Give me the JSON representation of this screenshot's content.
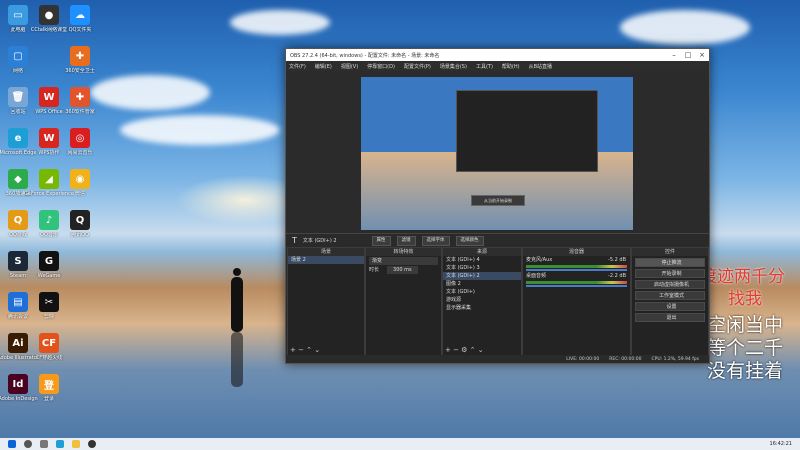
{
  "desktop_icons": [
    {
      "label": "此电脑",
      "glyph": "▭",
      "color": "#3b9be0"
    },
    {
      "label": "CCtalk网络课堂",
      "glyph": "●",
      "color": "#333"
    },
    {
      "label": "QQ文件夹",
      "glyph": "☁",
      "color": "#1e90ff"
    },
    {
      "label": "网络",
      "glyph": "▢",
      "color": "#2c7fd6"
    },
    {
      "label": "360安全卫士",
      "glyph": "✚",
      "color": "#e86d1f"
    },
    {
      "label": "回收站",
      "glyph": "🗑",
      "color": "#7aa6d6"
    },
    {
      "label": "WPS Office",
      "glyph": "W",
      "color": "#d8261f"
    },
    {
      "label": "360软件管家",
      "glyph": "✚",
      "color": "#e2542c"
    },
    {
      "label": "Microsoft Edge",
      "glyph": "e",
      "color": "#1d9fd6"
    },
    {
      "label": "WPS协作",
      "glyph": "W",
      "color": "#d8261f"
    },
    {
      "label": "网易云音乐",
      "glyph": "◎",
      "color": "#d81e1e"
    },
    {
      "label": "360加速球",
      "glyph": "◆",
      "color": "#2bab4a"
    },
    {
      "label": "GeForce Experience",
      "glyph": "◢",
      "color": "#76b900"
    },
    {
      "label": "微信",
      "glyph": "◉",
      "color": "#f0b11a"
    },
    {
      "label": "QQ游戏",
      "glyph": "Q",
      "color": "#e39b17"
    },
    {
      "label": "QQ音乐",
      "glyph": "♪",
      "color": "#31c27c"
    },
    {
      "label": "腾讯QQ",
      "glyph": "Q",
      "color": "#222"
    },
    {
      "label": "Steam",
      "glyph": "S",
      "color": "#1b2838"
    },
    {
      "label": "WeGame",
      "glyph": "G",
      "color": "#111"
    },
    {
      "label": "腾讯会议",
      "glyph": "▤",
      "color": "#1e6fd9"
    },
    {
      "label": "剪映",
      "glyph": "✂",
      "color": "#111"
    },
    {
      "label": "Adobe Illustrator",
      "glyph": "Ai",
      "color": "#3a1c00"
    },
    {
      "label": "CF穿越火线",
      "glyph": "CF",
      "color": "#e2531b"
    },
    {
      "label": "Adobe InDesign",
      "glyph": "Id",
      "color": "#49021f"
    },
    {
      "label": "登录",
      "glyph": "登",
      "color": "#f59a1b"
    }
  ],
  "overlay": {
    "red_line1": "渡迹两千分",
    "red_line2": "找我",
    "white_line1": "空闲当中",
    "white_line2": "等个二千",
    "white_line3": "没有挂着"
  },
  "obs": {
    "title": "OBS 27.2.4 (64-bit, windows) - 配置文件: 未命名 - 场景: 未命名",
    "menu": [
      "文件(F)",
      "编辑(E)",
      "视图(V)",
      "停靠窗口(D)",
      "配置文件(P)",
      "场景集合(S)",
      "工具(T)",
      "帮助(H)",
      "从B站直播"
    ],
    "preview_button": "从当前开始录制",
    "source_bar": {
      "current_source": "文本 (GDI+) 2",
      "properties": "属性",
      "filters": "滤镜",
      "select_font": "选择字体",
      "select_color": "选择颜色"
    },
    "scenes": {
      "header": "场景",
      "items": [
        "场景 2"
      ]
    },
    "transitions": {
      "header": "转场特效",
      "type": "渐变",
      "duration_label": "时长",
      "duration_value": "300 ms"
    },
    "sources": {
      "header": "来源",
      "items": [
        "文本 (GDI+) 4",
        "文本 (GDI+) 3",
        "文本 (GDI+) 2",
        "图像 2",
        "文本 (GDI+)",
        "游戏源",
        "显示器采集"
      ]
    },
    "mixer": {
      "header": "混音器",
      "tracks": [
        {
          "name": "麦克风/Aux",
          "db": "-5.2 dB"
        },
        {
          "name": "桌面音频",
          "db": "-2.2 dB"
        }
      ]
    },
    "controls": {
      "header": "控件",
      "buttons": [
        "停止推流",
        "开始录制",
        "启动虚拟摄像机",
        "工作室模式",
        "设置",
        "退出"
      ]
    },
    "status": {
      "live": "LIVE: 00:00:00",
      "rec": "REC: 00:00:00",
      "cpu": "CPU: 1.2%, 59.94 fps"
    }
  },
  "taskbar": {
    "clock": "16:42:21"
  }
}
